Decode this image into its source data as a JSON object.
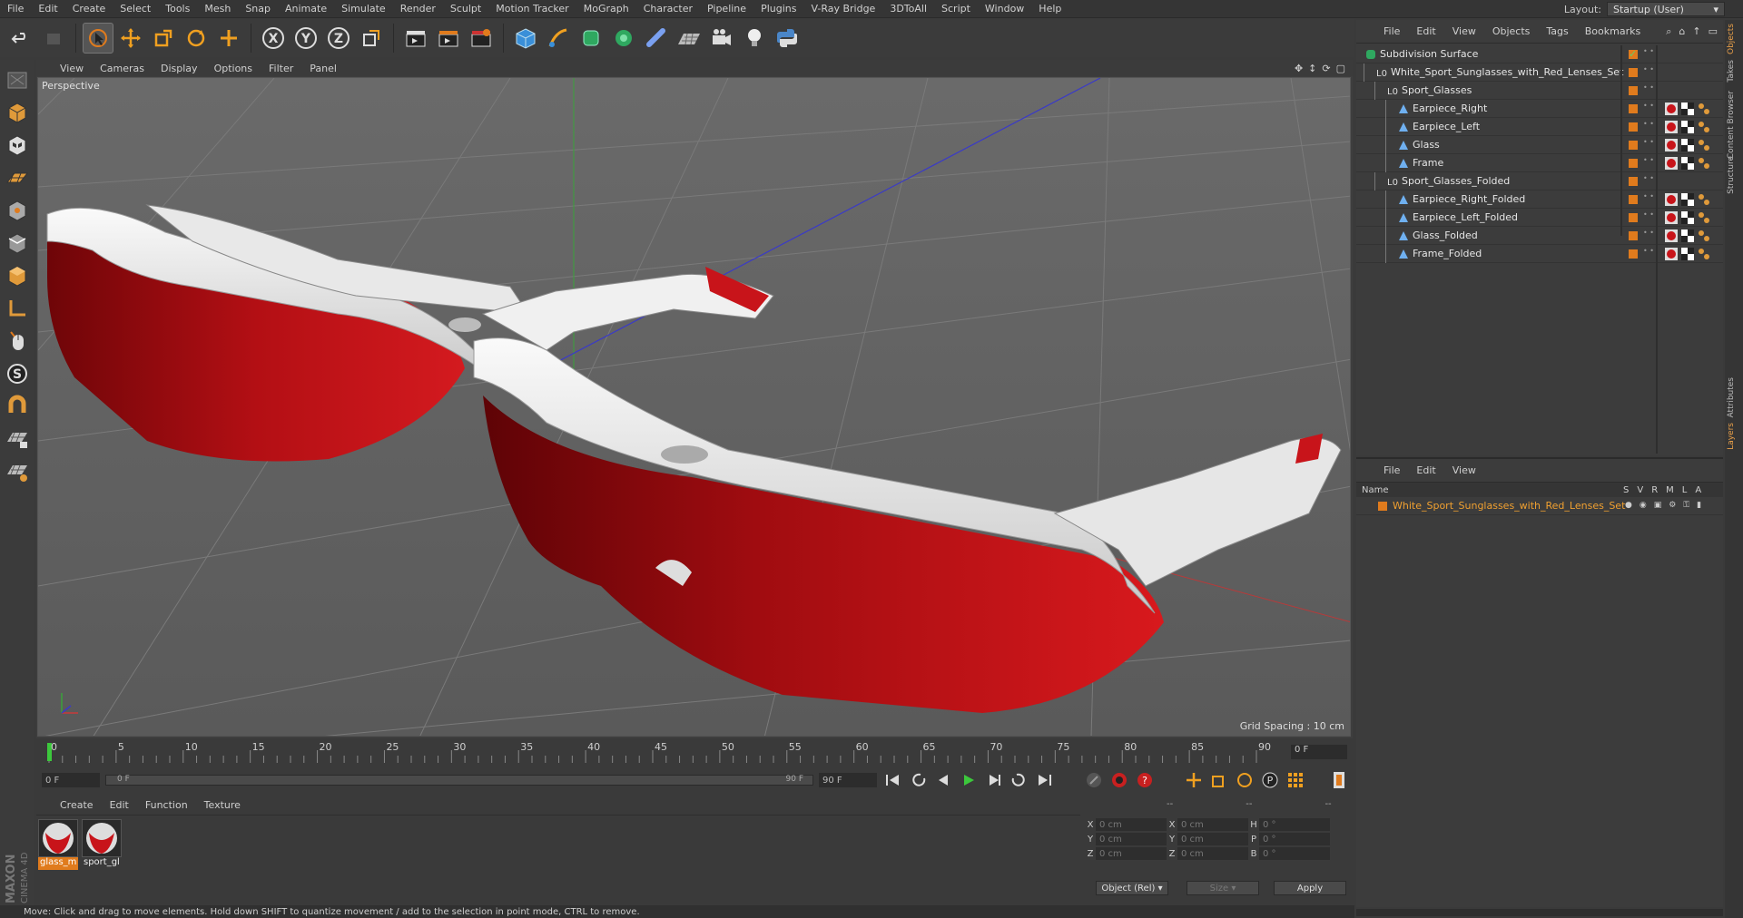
{
  "menu": [
    "File",
    "Edit",
    "Create",
    "Select",
    "Tools",
    "Mesh",
    "Snap",
    "Animate",
    "Simulate",
    "Render",
    "Sculpt",
    "Motion Tracker",
    "MoGraph",
    "Character",
    "Pipeline",
    "Plugins",
    "V-Ray Bridge",
    "3DToAll",
    "Script",
    "Window",
    "Help"
  ],
  "layout": {
    "label": "Layout:",
    "value": "Startup (User)"
  },
  "viewport": {
    "menu": [
      "View",
      "Cameras",
      "Display",
      "Options",
      "Filter",
      "Panel"
    ],
    "label": "Perspective",
    "grid_spacing": "Grid Spacing : 10 cm"
  },
  "timeline": {
    "ticks": [
      "0",
      "5",
      "10",
      "15",
      "20",
      "25",
      "30",
      "35",
      "40",
      "45",
      "50",
      "55",
      "60",
      "65",
      "70",
      "75",
      "80",
      "85",
      "90"
    ],
    "current_frame": "0 F"
  },
  "playbar": {
    "start": "0 F",
    "slider_start": "0 F",
    "slider_end": "90 F",
    "end": "90 F"
  },
  "materials": {
    "menu": [
      "Create",
      "Edit",
      "Function",
      "Texture"
    ],
    "items": [
      {
        "name": "glass_m",
        "selected": true
      },
      {
        "name": "sport_gl",
        "selected": false
      }
    ]
  },
  "coords": {
    "rows": [
      {
        "a1": "X",
        "v1": "0 cm",
        "a2": "X",
        "v2": "0 cm",
        "a3": "H",
        "v3": "0 °"
      },
      {
        "a1": "Y",
        "v1": "0 cm",
        "a2": "Y",
        "v2": "0 cm",
        "a3": "P",
        "v3": "0 °"
      },
      {
        "a1": "Z",
        "v1": "0 cm",
        "a2": "Z",
        "v2": "0 cm",
        "a3": "B",
        "v3": "0 °"
      }
    ],
    "mode": "Object (Rel)",
    "size": "Size",
    "apply": "Apply",
    "header_dashes": [
      "--",
      "--",
      "--"
    ]
  },
  "status": "Move: Click and drag to move elements. Hold down SHIFT to quantize movement / add to the selection in point mode, CTRL to remove.",
  "objects": {
    "menu": [
      "File",
      "Edit",
      "View",
      "Objects",
      "Tags",
      "Bookmarks"
    ],
    "tree": [
      {
        "name": "Subdivision Surface",
        "indent": 0,
        "icon": "subdiv",
        "tags": false
      },
      {
        "name": "White_Sport_Sunglasses_with_Red_Lenses_Set",
        "indent": 1,
        "icon": "null",
        "tags": false
      },
      {
        "name": "Sport_Glasses",
        "indent": 2,
        "icon": "null",
        "tags": false
      },
      {
        "name": "Earpiece_Right",
        "indent": 3,
        "icon": "poly",
        "tags": true
      },
      {
        "name": "Earpiece_Left",
        "indent": 3,
        "icon": "poly",
        "tags": true
      },
      {
        "name": "Glass",
        "indent": 3,
        "icon": "poly",
        "tags": true
      },
      {
        "name": "Frame",
        "indent": 3,
        "icon": "poly",
        "tags": true
      },
      {
        "name": "Sport_Glasses_Folded",
        "indent": 2,
        "icon": "null",
        "tags": false
      },
      {
        "name": "Earpiece_Right_Folded",
        "indent": 3,
        "icon": "poly",
        "tags": true
      },
      {
        "name": "Earpiece_Left_Folded",
        "indent": 3,
        "icon": "poly",
        "tags": true
      },
      {
        "name": "Glass_Folded",
        "indent": 3,
        "icon": "poly",
        "tags": true
      },
      {
        "name": "Frame_Folded",
        "indent": 3,
        "icon": "poly",
        "tags": true
      }
    ]
  },
  "layers": {
    "menu": [
      "File",
      "Edit",
      "View"
    ],
    "header": {
      "name": "Name",
      "cols": [
        "S",
        "V",
        "R",
        "M",
        "L",
        "A"
      ]
    },
    "rows": [
      {
        "name": "White_Sport_Sunglasses_with_Red_Lenses_Set"
      }
    ]
  },
  "side_tabs": [
    "Objects",
    "Takes",
    "Content Browser",
    "Structure",
    "Attributes",
    "Layers"
  ],
  "brand": {
    "line1": "MAXON",
    "line2": "CINEMA 4D"
  },
  "colors": {
    "accent": "#e07b1d",
    "lens_red": "#c8141a",
    "bg": "#3a3a3a"
  }
}
